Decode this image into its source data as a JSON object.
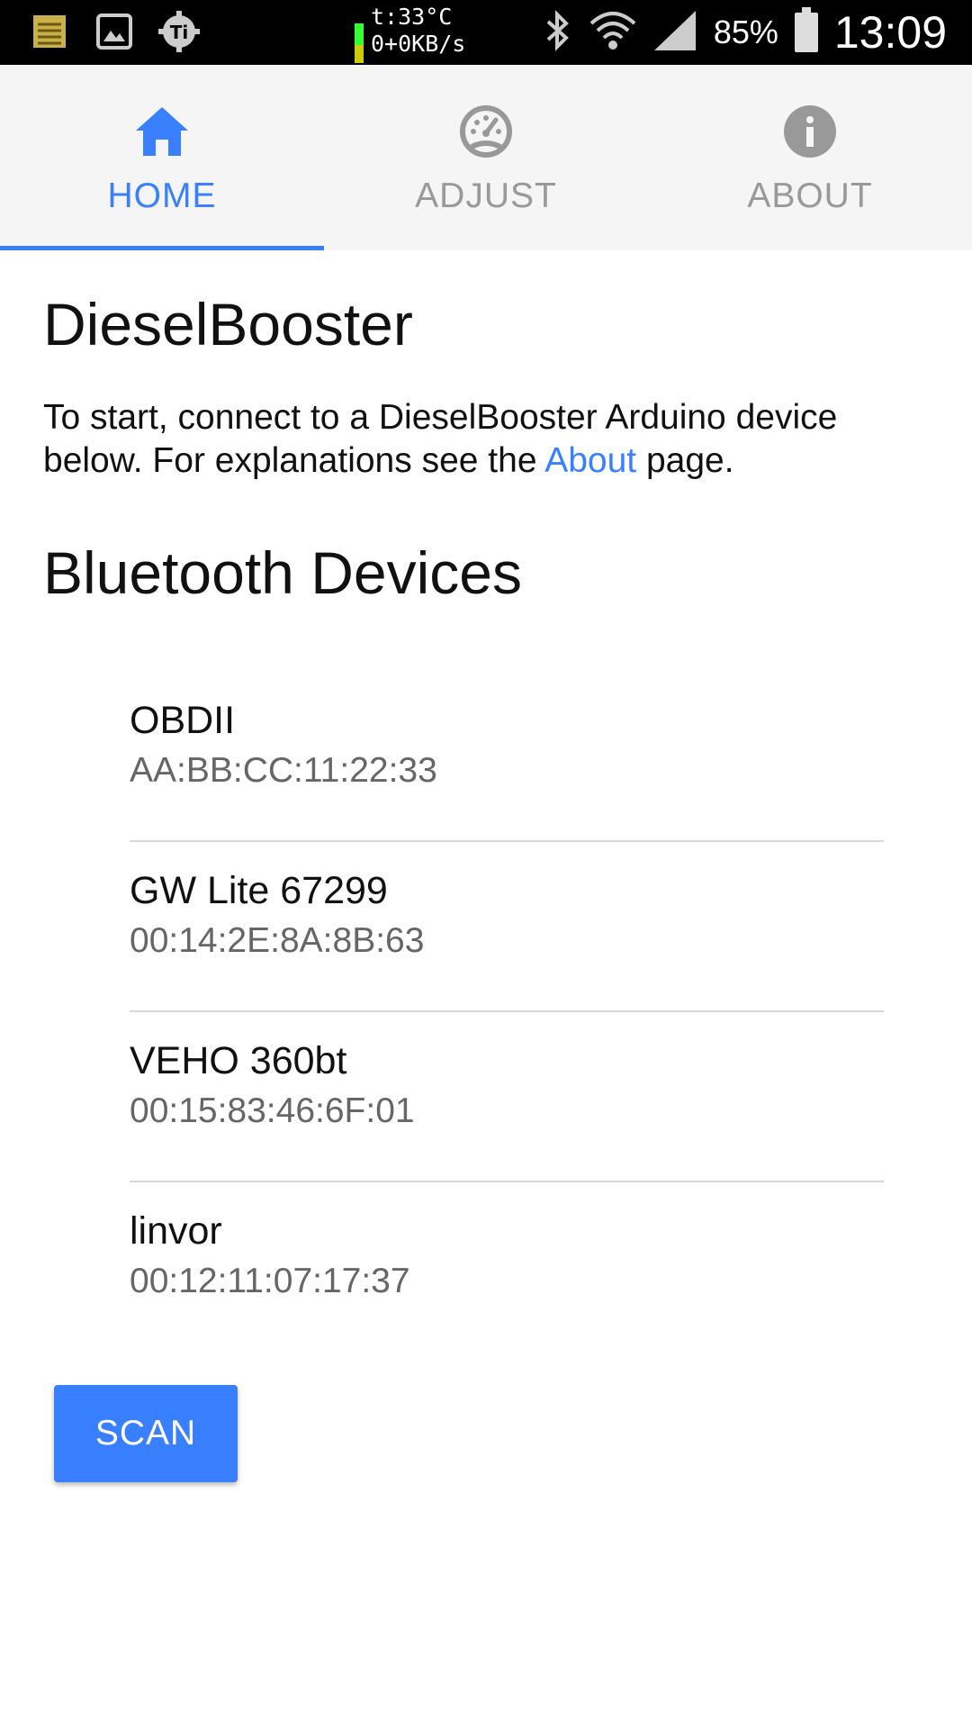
{
  "status_bar": {
    "temperature": "t:33°C",
    "network_speed": "0+0KB/s",
    "battery_percent": "85%",
    "time": "13:09"
  },
  "tabs": [
    {
      "label": "HOME",
      "icon": "home-icon",
      "active": true
    },
    {
      "label": "ADJUST",
      "icon": "speedometer-icon",
      "active": false
    },
    {
      "label": "ABOUT",
      "icon": "info-icon",
      "active": false
    }
  ],
  "main": {
    "title": "DieselBooster",
    "intro_before": "To start, connect to a DieselBooster Arduino device below. For explanations see the ",
    "intro_link": "About",
    "intro_after": " page.",
    "devices_heading": "Bluetooth Devices",
    "devices": [
      {
        "name": "OBDII",
        "address": "AA:BB:CC:11:22:33"
      },
      {
        "name": "GW Lite 67299",
        "address": "00:14:2E:8A:8B:63"
      },
      {
        "name": "VEHO 360bt",
        "address": "00:15:83:46:6F:01"
      },
      {
        "name": "linvor",
        "address": "00:12:11:07:17:37"
      }
    ],
    "scan_label": "SCAN"
  },
  "colors": {
    "accent": "#3880ff",
    "inactive_tab": "#999999",
    "status_bar": "#000000"
  }
}
